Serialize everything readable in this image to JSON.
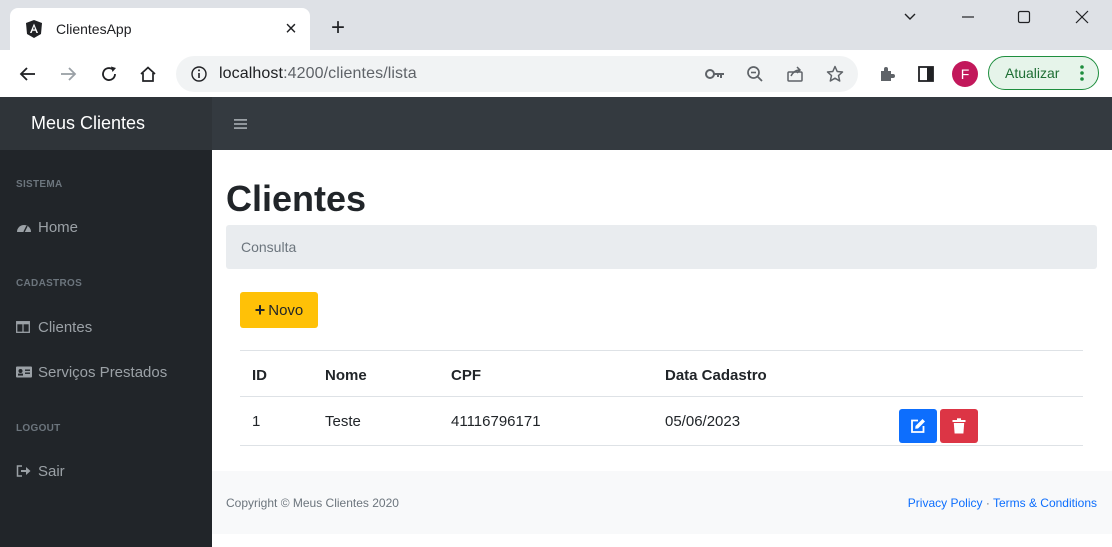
{
  "browser": {
    "tab_title": "ClientesApp",
    "url_host": "localhost",
    "url_rest": ":4200/clientes/lista",
    "profile_initial": "F",
    "update_label": "Atualizar"
  },
  "app": {
    "brand": "Meus Clientes"
  },
  "sidebar": {
    "sections": [
      {
        "heading": "SISTEMA",
        "items": [
          {
            "label": "Home",
            "icon": "tachometer-icon"
          }
        ]
      },
      {
        "heading": "CADASTROS",
        "items": [
          {
            "label": "Clientes",
            "icon": "table-icon"
          },
          {
            "label": "Serviços Prestados",
            "icon": "id-card-icon"
          }
        ]
      },
      {
        "heading": "LOGOUT",
        "items": [
          {
            "label": "Sair",
            "icon": "sign-out-icon"
          }
        ]
      }
    ]
  },
  "main": {
    "title": "Clientes",
    "breadcrumb": "Consulta",
    "new_button": "Novo",
    "table": {
      "headers": [
        "ID",
        "Nome",
        "CPF",
        "Data Cadastro"
      ],
      "rows": [
        {
          "id": "1",
          "nome": "Teste",
          "cpf": "41116796171",
          "data_cadastro": "05/06/2023"
        }
      ]
    }
  },
  "footer": {
    "copyright": "Copyright © Meus Clientes 2020",
    "privacy": "Privacy Policy",
    "separator": "·",
    "terms": "Terms & Conditions"
  },
  "colors": {
    "topnav": "#343a40",
    "sidebar": "#212529",
    "warning": "#ffc107",
    "primary": "#0d6efd",
    "danger": "#dc3545"
  }
}
